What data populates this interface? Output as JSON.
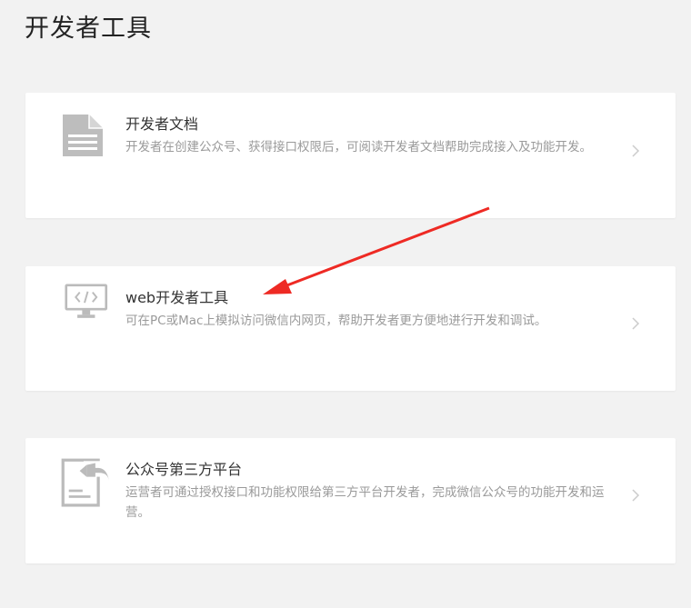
{
  "page": {
    "title": "开发者工具"
  },
  "cards": [
    {
      "title": "开发者文档",
      "description": "开发者在创建公众号、获得接口权限后，可阅读开发者文档帮助完成接入及功能开发。",
      "icon": "document-icon"
    },
    {
      "title": "web开发者工具",
      "description": "可在PC或Mac上模拟访问微信内网页，帮助开发者更方便地进行开发和调试。",
      "icon": "monitor-code-icon"
    },
    {
      "title": "公众号第三方平台",
      "description": "运营者可通过授权接口和功能权限给第三方平台开发者，完成微信公众号的功能开发和运营。",
      "icon": "authorization-document-icon"
    }
  ],
  "annotation": {
    "type": "red-arrow",
    "color": "#ee2a24"
  },
  "colors": {
    "background": "#f2f2f2",
    "card": "#ffffff",
    "icon": "#b7b7b7",
    "chevron": "#cccccc"
  }
}
